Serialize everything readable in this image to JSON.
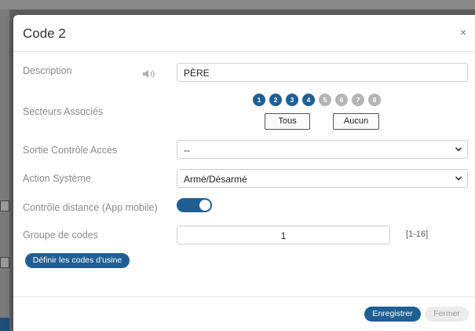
{
  "dialog": {
    "title": "Code 2",
    "close_glyph": "×"
  },
  "form": {
    "description_label": "Description",
    "description_value": "PÈRE",
    "sectors_label": "Secteurs Associés",
    "sectors": [
      {
        "label": "1",
        "active": true
      },
      {
        "label": "2",
        "active": true
      },
      {
        "label": "3",
        "active": true
      },
      {
        "label": "4",
        "active": true
      },
      {
        "label": "5",
        "active": false
      },
      {
        "label": "6",
        "active": false
      },
      {
        "label": "7",
        "active": false
      },
      {
        "label": "8",
        "active": false
      }
    ],
    "all_button": "Tous",
    "none_button": "Aucun",
    "access_output_label": "Sortie Contrôle Accès",
    "access_output_value": "--",
    "system_action_label": "Action Système",
    "system_action_value": "Armé/Désarmé",
    "remote_control_label": "Contrôle distance (App mobile)",
    "remote_control_on": true,
    "code_group_label": "Groupe de codes",
    "code_group_value": "1",
    "code_group_range": "[1-16]",
    "factory_codes_button": "Définir les codes d'usine"
  },
  "footer": {
    "save_button": "Enregistrer",
    "close_button": "Fermer"
  },
  "icons": {
    "speaker": "speaker-icon",
    "chevron": "chevron-down-icon",
    "close": "close-icon"
  },
  "colors": {
    "primary": "#1f5f93",
    "inactive_sector": "#b5b5b5"
  }
}
